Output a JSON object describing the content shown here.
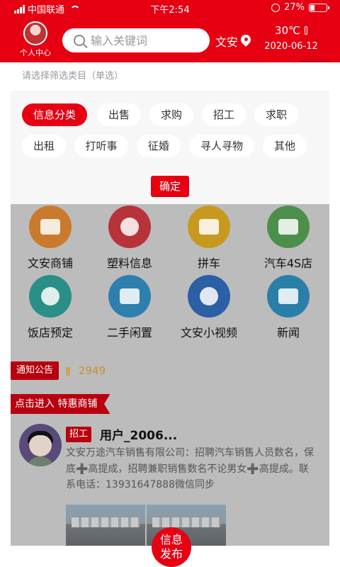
{
  "status_bar": {
    "carrier": "中国联通",
    "time": "下午2:54",
    "battery_text": "27%",
    "battery_level": 0.27
  },
  "header": {
    "profile_label": "个人中心",
    "search_placeholder": "输入关键词",
    "city": "文安",
    "temperature": "30℃",
    "date": "2020-06-12"
  },
  "filter": {
    "hint": "请选择筛选类目（单选）",
    "chips": [
      "信息分类",
      "出售",
      "求购",
      "招工",
      "求职",
      "出租",
      "打听事",
      "征婚",
      "寻人寻物",
      "其他"
    ],
    "active_chip": "信息分类",
    "confirm_label": "确定"
  },
  "grid": [
    {
      "label": "文安商铺",
      "icon": "shop-icon",
      "color": "#c97a2c"
    },
    {
      "label": "塑料信息",
      "icon": "chat-icon",
      "color": "#b8323a"
    },
    {
      "label": "拼车",
      "icon": "car-icon",
      "color": "#c79a1f"
    },
    {
      "label": "汽车4S店",
      "icon": "car-4s-icon",
      "color": "#4c8f4a"
    },
    {
      "label": "饭店预定",
      "icon": "phone-icon",
      "color": "#2a8f86"
    },
    {
      "label": "二手闲置",
      "icon": "secondhand-icon",
      "color": "#2d7fae"
    },
    {
      "label": "文安小视频",
      "icon": "dancer-icon",
      "color": "#2b5fa6"
    },
    {
      "label": "新闻",
      "icon": "tv-news-icon",
      "color": "#2a7fa8"
    }
  ],
  "notice": {
    "tag": "通知公告",
    "count": "2949"
  },
  "ribbon": {
    "label": "点击进入 特惠商铺"
  },
  "post": {
    "tag": "招工",
    "user": "用户_2006...",
    "body": "文安万途汽车销售有限公司：招聘汽车销售人员数名，保底➕高提成，招聘兼职销售数名不论男女➕高提成。联系电话：13931647888微信同步"
  },
  "fab": {
    "line1": "信息",
    "line2": "发布"
  }
}
